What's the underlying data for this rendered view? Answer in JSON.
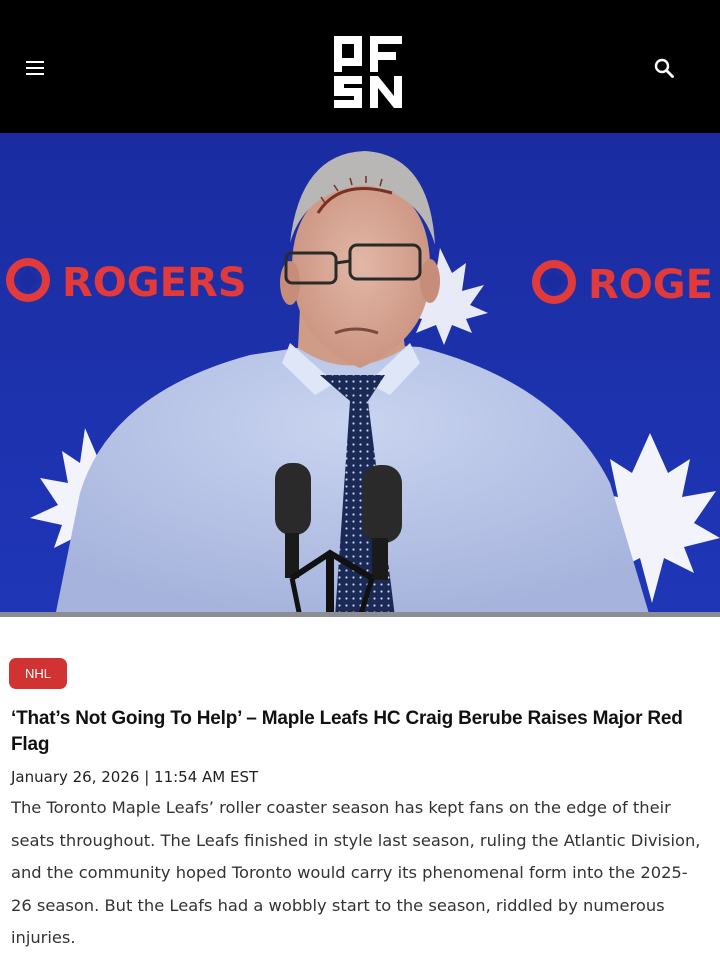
{
  "header": {
    "background": "#000000",
    "menu_icon": "hamburger-menu-icon",
    "logo": {
      "letters": [
        "P",
        "F",
        "S",
        "N"
      ]
    },
    "search_icon": "magnifier-icon"
  },
  "hero": {
    "sponsor_text": "ROGERS",
    "sponsor_text_partial": "ROGE",
    "backdrop_color": "#1c2fa8",
    "accent_color": "#e23a3b"
  },
  "article": {
    "category": "NHL",
    "category_color": "#d03332",
    "headline": "‘That’s Not Going To Help’ – Maple Leafs HC Craig Berube Raises Major Red Flag",
    "dateline": "January 26, 2026 | 11:54 AM EST",
    "body": "The Toronto Maple Leafs’ roller coaster season has kept fans on the edge of their seats throughout. The Leafs finished in style last season, ruling the Atlantic Division, and the community hoped Toronto would carry its phenomenal form into the 2025-26 season. But the Leafs had a wobbly start to the season, riddled by numerous injuries."
  }
}
